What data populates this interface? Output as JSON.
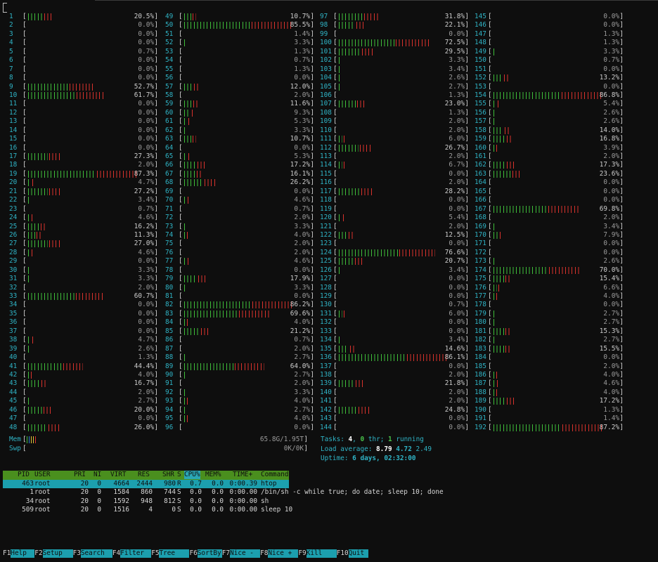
{
  "cpus": [
    {
      "id": "1",
      "pct": "20.5%",
      "v": 20.5
    },
    {
      "id": "2",
      "pct": "0.0%",
      "v": 0
    },
    {
      "id": "3",
      "pct": "0.0%",
      "v": 0
    },
    {
      "id": "4",
      "pct": "0.0%",
      "v": 0
    },
    {
      "id": "5",
      "pct": "0.7%",
      "v": 0.7
    },
    {
      "id": "6",
      "pct": "0.0%",
      "v": 0
    },
    {
      "id": "7",
      "pct": "0.0%",
      "v": 0
    },
    {
      "id": "8",
      "pct": "0.0%",
      "v": 0
    },
    {
      "id": "9",
      "pct": "52.7%",
      "v": 52.7
    },
    {
      "id": "10",
      "pct": "61.7%",
      "v": 61.7
    },
    {
      "id": "11",
      "pct": "0.0%",
      "v": 0
    },
    {
      "id": "12",
      "pct": "0.0%",
      "v": 0
    },
    {
      "id": "13",
      "pct": "0.0%",
      "v": 0
    },
    {
      "id": "14",
      "pct": "0.0%",
      "v": 0
    },
    {
      "id": "15",
      "pct": "0.0%",
      "v": 0
    },
    {
      "id": "16",
      "pct": "0.0%",
      "v": 0
    },
    {
      "id": "17",
      "pct": "27.3%",
      "v": 27.3
    },
    {
      "id": "18",
      "pct": "2.0%",
      "v": 2
    },
    {
      "id": "19",
      "pct": "87.3%",
      "v": 87.3
    },
    {
      "id": "20",
      "pct": "4.7%",
      "v": 4.7
    },
    {
      "id": "21",
      "pct": "27.2%",
      "v": 27.2
    },
    {
      "id": "22",
      "pct": "3.4%",
      "v": 3.4
    },
    {
      "id": "23",
      "pct": "0.7%",
      "v": 0.7
    },
    {
      "id": "24",
      "pct": "4.6%",
      "v": 4.6
    },
    {
      "id": "25",
      "pct": "16.2%",
      "v": 16.2
    },
    {
      "id": "26",
      "pct": "11.3%",
      "v": 11.3
    },
    {
      "id": "27",
      "pct": "27.0%",
      "v": 27
    },
    {
      "id": "28",
      "pct": "4.6%",
      "v": 4.6
    },
    {
      "id": "29",
      "pct": "0.0%",
      "v": 0
    },
    {
      "id": "30",
      "pct": "3.3%",
      "v": 3.3
    },
    {
      "id": "31",
      "pct": "3.3%",
      "v": 3.3
    },
    {
      "id": "32",
      "pct": "2.0%",
      "v": 2
    },
    {
      "id": "33",
      "pct": "60.7%",
      "v": 60.7
    },
    {
      "id": "34",
      "pct": "0.0%",
      "v": 0
    },
    {
      "id": "35",
      "pct": "0.0%",
      "v": 0
    },
    {
      "id": "36",
      "pct": "0.0%",
      "v": 0
    },
    {
      "id": "37",
      "pct": "0.0%",
      "v": 0
    },
    {
      "id": "38",
      "pct": "4.7%",
      "v": 4.7
    },
    {
      "id": "39",
      "pct": "2.6%",
      "v": 2.6
    },
    {
      "id": "40",
      "pct": "1.3%",
      "v": 1.3
    },
    {
      "id": "41",
      "pct": "44.4%",
      "v": 44.4
    },
    {
      "id": "42",
      "pct": "4.0%",
      "v": 4
    },
    {
      "id": "43",
      "pct": "16.7%",
      "v": 16.7
    },
    {
      "id": "44",
      "pct": "2.0%",
      "v": 2
    },
    {
      "id": "45",
      "pct": "2.7%",
      "v": 2.7
    },
    {
      "id": "46",
      "pct": "20.0%",
      "v": 20
    },
    {
      "id": "47",
      "pct": "0.0%",
      "v": 0
    },
    {
      "id": "48",
      "pct": "26.0%",
      "v": 26
    },
    {
      "id": "49",
      "pct": "10.7%",
      "v": 10.7
    },
    {
      "id": "50",
      "pct": "85.5%",
      "v": 85.5
    },
    {
      "id": "51",
      "pct": "1.4%",
      "v": 1.4
    },
    {
      "id": "52",
      "pct": "3.3%",
      "v": 3.3
    },
    {
      "id": "53",
      "pct": "1.3%",
      "v": 1.3
    },
    {
      "id": "54",
      "pct": "0.7%",
      "v": 0.7
    },
    {
      "id": "55",
      "pct": "1.3%",
      "v": 1.3
    },
    {
      "id": "56",
      "pct": "0.0%",
      "v": 0
    },
    {
      "id": "57",
      "pct": "12.0%",
      "v": 12
    },
    {
      "id": "58",
      "pct": "2.0%",
      "v": 2
    },
    {
      "id": "59",
      "pct": "11.6%",
      "v": 11.6
    },
    {
      "id": "60",
      "pct": "9.3%",
      "v": 9.3
    },
    {
      "id": "61",
      "pct": "5.3%",
      "v": 5.3
    },
    {
      "id": "62",
      "pct": "3.3%",
      "v": 3.3
    },
    {
      "id": "63",
      "pct": "10.7%",
      "v": 10.7
    },
    {
      "id": "64",
      "pct": "0.0%",
      "v": 0
    },
    {
      "id": "65",
      "pct": "5.3%",
      "v": 5.3
    },
    {
      "id": "66",
      "pct": "17.2%",
      "v": 17.2
    },
    {
      "id": "67",
      "pct": "16.1%",
      "v": 16.1
    },
    {
      "id": "68",
      "pct": "26.2%",
      "v": 26.2
    },
    {
      "id": "69",
      "pct": "0.0%",
      "v": 0
    },
    {
      "id": "70",
      "pct": "4.6%",
      "v": 4.6
    },
    {
      "id": "71",
      "pct": "0.7%",
      "v": 0.7
    },
    {
      "id": "72",
      "pct": "2.0%",
      "v": 2
    },
    {
      "id": "73",
      "pct": "3.3%",
      "v": 3.3
    },
    {
      "id": "74",
      "pct": "4.0%",
      "v": 4
    },
    {
      "id": "75",
      "pct": "2.0%",
      "v": 2
    },
    {
      "id": "76",
      "pct": "2.0%",
      "v": 2
    },
    {
      "id": "77",
      "pct": "4.6%",
      "v": 4.6
    },
    {
      "id": "78",
      "pct": "0.0%",
      "v": 0
    },
    {
      "id": "79",
      "pct": "17.9%",
      "v": 17.9
    },
    {
      "id": "80",
      "pct": "3.3%",
      "v": 3.3
    },
    {
      "id": "81",
      "pct": "0.0%",
      "v": 0
    },
    {
      "id": "82",
      "pct": "86.2%",
      "v": 86.2
    },
    {
      "id": "83",
      "pct": "69.6%",
      "v": 69.6
    },
    {
      "id": "84",
      "pct": "4.0%",
      "v": 4
    },
    {
      "id": "85",
      "pct": "21.2%",
      "v": 21.2
    },
    {
      "id": "86",
      "pct": "0.7%",
      "v": 0.7
    },
    {
      "id": "87",
      "pct": "2.0%",
      "v": 2
    },
    {
      "id": "88",
      "pct": "2.7%",
      "v": 2.7
    },
    {
      "id": "89",
      "pct": "64.0%",
      "v": 64
    },
    {
      "id": "90",
      "pct": "2.7%",
      "v": 2.7
    },
    {
      "id": "91",
      "pct": "2.0%",
      "v": 2
    },
    {
      "id": "92",
      "pct": "3.3%",
      "v": 3.3
    },
    {
      "id": "93",
      "pct": "4.0%",
      "v": 4
    },
    {
      "id": "94",
      "pct": "2.7%",
      "v": 2.7
    },
    {
      "id": "95",
      "pct": "4.0%",
      "v": 4
    },
    {
      "id": "96",
      "pct": "0.0%",
      "v": 0
    },
    {
      "id": "97",
      "pct": "31.8%",
      "v": 31.8
    },
    {
      "id": "98",
      "pct": "22.1%",
      "v": 22.1
    },
    {
      "id": "99",
      "pct": "0.0%",
      "v": 0
    },
    {
      "id": "100",
      "pct": "72.5%",
      "v": 72.5
    },
    {
      "id": "101",
      "pct": "29.5%",
      "v": 29.5
    },
    {
      "id": "102",
      "pct": "3.3%",
      "v": 3.3
    },
    {
      "id": "103",
      "pct": "3.4%",
      "v": 3.4
    },
    {
      "id": "104",
      "pct": "2.6%",
      "v": 2.6
    },
    {
      "id": "105",
      "pct": "2.7%",
      "v": 2.7
    },
    {
      "id": "106",
      "pct": "1.3%",
      "v": 1.3
    },
    {
      "id": "107",
      "pct": "23.0%",
      "v": 23
    },
    {
      "id": "108",
      "pct": "1.3%",
      "v": 1.3
    },
    {
      "id": "109",
      "pct": "2.0%",
      "v": 2
    },
    {
      "id": "110",
      "pct": "2.0%",
      "v": 2
    },
    {
      "id": "111",
      "pct": "6.0%",
      "v": 6
    },
    {
      "id": "112",
      "pct": "26.7%",
      "v": 26.7
    },
    {
      "id": "113",
      "pct": "2.0%",
      "v": 2
    },
    {
      "id": "114",
      "pct": "6.7%",
      "v": 6.7
    },
    {
      "id": "115",
      "pct": "0.0%",
      "v": 0
    },
    {
      "id": "116",
      "pct": "2.0%",
      "v": 2
    },
    {
      "id": "117",
      "pct": "28.2%",
      "v": 28.2
    },
    {
      "id": "118",
      "pct": "0.0%",
      "v": 0
    },
    {
      "id": "119",
      "pct": "0.0%",
      "v": 0
    },
    {
      "id": "120",
      "pct": "5.4%",
      "v": 5.4
    },
    {
      "id": "121",
      "pct": "2.0%",
      "v": 2
    },
    {
      "id": "122",
      "pct": "12.5%",
      "v": 12.5
    },
    {
      "id": "123",
      "pct": "0.0%",
      "v": 0
    },
    {
      "id": "124",
      "pct": "76.6%",
      "v": 76.6
    },
    {
      "id": "125",
      "pct": "20.7%",
      "v": 20.7
    },
    {
      "id": "126",
      "pct": "3.4%",
      "v": 3.4
    },
    {
      "id": "127",
      "pct": "0.0%",
      "v": 0
    },
    {
      "id": "128",
      "pct": "0.0%",
      "v": 0
    },
    {
      "id": "129",
      "pct": "0.0%",
      "v": 0
    },
    {
      "id": "130",
      "pct": "0.7%",
      "v": 0.7
    },
    {
      "id": "131",
      "pct": "6.0%",
      "v": 6
    },
    {
      "id": "132",
      "pct": "0.0%",
      "v": 0
    },
    {
      "id": "133",
      "pct": "0.0%",
      "v": 0
    },
    {
      "id": "134",
      "pct": "3.4%",
      "v": 3.4
    },
    {
      "id": "135",
      "pct": "14.6%",
      "v": 14.6
    },
    {
      "id": "136",
      "pct": "86.1%",
      "v": 86.1
    },
    {
      "id": "137",
      "pct": "0.0%",
      "v": 0
    },
    {
      "id": "138",
      "pct": "2.0%",
      "v": 2
    },
    {
      "id": "139",
      "pct": "21.8%",
      "v": 21.8
    },
    {
      "id": "140",
      "pct": "2.0%",
      "v": 2
    },
    {
      "id": "141",
      "pct": "2.0%",
      "v": 2
    },
    {
      "id": "142",
      "pct": "24.8%",
      "v": 24.8
    },
    {
      "id": "143",
      "pct": "0.0%",
      "v": 0
    },
    {
      "id": "144",
      "pct": "0.0%",
      "v": 0
    },
    {
      "id": "145",
      "pct": "0.0%",
      "v": 0
    },
    {
      "id": "146",
      "pct": "0.0%",
      "v": 0
    },
    {
      "id": "147",
      "pct": "1.3%",
      "v": 1.3
    },
    {
      "id": "148",
      "pct": "1.3%",
      "v": 1.3
    },
    {
      "id": "149",
      "pct": "3.3%",
      "v": 3.3
    },
    {
      "id": "150",
      "pct": "0.7%",
      "v": 0.7
    },
    {
      "id": "151",
      "pct": "0.0%",
      "v": 0
    },
    {
      "id": "152",
      "pct": "13.2%",
      "v": 13.2
    },
    {
      "id": "153",
      "pct": "0.0%",
      "v": 0
    },
    {
      "id": "154",
      "pct": "86.8%",
      "v": 86.8
    },
    {
      "id": "155",
      "pct": "5.4%",
      "v": 5.4
    },
    {
      "id": "156",
      "pct": "2.6%",
      "v": 2.6
    },
    {
      "id": "157",
      "pct": "2.6%",
      "v": 2.6
    },
    {
      "id": "158",
      "pct": "14.0%",
      "v": 14
    },
    {
      "id": "159",
      "pct": "16.8%",
      "v": 16.8
    },
    {
      "id": "160",
      "pct": "3.9%",
      "v": 3.9
    },
    {
      "id": "161",
      "pct": "2.0%",
      "v": 2
    },
    {
      "id": "162",
      "pct": "17.3%",
      "v": 17.3
    },
    {
      "id": "163",
      "pct": "23.6%",
      "v": 23.6
    },
    {
      "id": "164",
      "pct": "0.0%",
      "v": 0
    },
    {
      "id": "165",
      "pct": "0.0%",
      "v": 0
    },
    {
      "id": "166",
      "pct": "0.0%",
      "v": 0
    },
    {
      "id": "167",
      "pct": "69.8%",
      "v": 69.8
    },
    {
      "id": "168",
      "pct": "2.0%",
      "v": 2
    },
    {
      "id": "169",
      "pct": "3.4%",
      "v": 3.4
    },
    {
      "id": "170",
      "pct": "7.9%",
      "v": 7.9
    },
    {
      "id": "171",
      "pct": "0.0%",
      "v": 0
    },
    {
      "id": "172",
      "pct": "0.0%",
      "v": 0
    },
    {
      "id": "173",
      "pct": "2.6%",
      "v": 2.6
    },
    {
      "id": "174",
      "pct": "70.0%",
      "v": 70
    },
    {
      "id": "175",
      "pct": "15.4%",
      "v": 15.4
    },
    {
      "id": "176",
      "pct": "6.6%",
      "v": 6.6
    },
    {
      "id": "177",
      "pct": "4.0%",
      "v": 4
    },
    {
      "id": "178",
      "pct": "0.0%",
      "v": 0
    },
    {
      "id": "179",
      "pct": "2.7%",
      "v": 2.7
    },
    {
      "id": "180",
      "pct": "2.7%",
      "v": 2.7
    },
    {
      "id": "181",
      "pct": "15.3%",
      "v": 15.3
    },
    {
      "id": "182",
      "pct": "2.7%",
      "v": 2.7
    },
    {
      "id": "183",
      "pct": "15.5%",
      "v": 15.5
    },
    {
      "id": "184",
      "pct": "0.0%",
      "v": 0
    },
    {
      "id": "185",
      "pct": "2.0%",
      "v": 2
    },
    {
      "id": "186",
      "pct": "4.0%",
      "v": 4
    },
    {
      "id": "187",
      "pct": "4.6%",
      "v": 4.6
    },
    {
      "id": "188",
      "pct": "4.0%",
      "v": 4
    },
    {
      "id": "189",
      "pct": "17.2%",
      "v": 17.2
    },
    {
      "id": "190",
      "pct": "1.3%",
      "v": 1.3
    },
    {
      "id": "191",
      "pct": "1.4%",
      "v": 1.4
    },
    {
      "id": "192",
      "pct": "87.2%",
      "v": 87.2
    }
  ],
  "memory": {
    "label": "Mem",
    "value": "65.8G/1.95T",
    "used_fraction": 0.035
  },
  "swap": {
    "label": "Swp",
    "value": "0K/0K",
    "used_fraction": 0
  },
  "tasks": {
    "label": "Tasks:",
    "count": "4",
    "sep1": ",",
    "thr": "0",
    "thr_label": "thr;",
    "running": "1",
    "running_label": "running"
  },
  "load": {
    "label": "Load average:",
    "l1": "8.79",
    "l5": "4.72",
    "l15": "2.49"
  },
  "uptime": {
    "label": "Uptime:",
    "value": "6 days, 02:32:00"
  },
  "columns": [
    "PID",
    "USER",
    "PRI",
    "NI",
    "VIRT",
    "RES",
    "SHR",
    "S",
    "CPU%",
    "MEM%",
    "TIME+",
    "Command"
  ],
  "processes": [
    {
      "pid": "463",
      "user": "root",
      "pri": "20",
      "ni": "0",
      "virt": "4664",
      "res": "2444",
      "shr": "980",
      "s": "R",
      "cpu": "0.7",
      "mem": "0.0",
      "time": "0:00.39",
      "cmd": "htop"
    },
    {
      "pid": "1",
      "user": "root",
      "pri": "20",
      "ni": "0",
      "virt": "1584",
      "res": "860",
      "shr": "744",
      "s": "S",
      "cpu": "0.0",
      "mem": "0.0",
      "time": "0:00.00",
      "cmd": "/bin/sh -c while true; do date; sleep 10; done"
    },
    {
      "pid": "34",
      "user": "root",
      "pri": "20",
      "ni": "0",
      "virt": "1592",
      "res": "948",
      "shr": "812",
      "s": "S",
      "cpu": "0.0",
      "mem": "0.0",
      "time": "0:00.00",
      "cmd": "sh"
    },
    {
      "pid": "509",
      "user": "root",
      "pri": "20",
      "ni": "0",
      "virt": "1516",
      "res": "4",
      "shr": "0",
      "s": "S",
      "cpu": "0.0",
      "mem": "0.0",
      "time": "0:00.00",
      "cmd": "sleep 10"
    }
  ],
  "fkeys": [
    {
      "key": "F1",
      "label": "Help"
    },
    {
      "key": "F2",
      "label": "Setup"
    },
    {
      "key": "F3",
      "label": "Search"
    },
    {
      "key": "F4",
      "label": "Filter"
    },
    {
      "key": "F5",
      "label": "Tree"
    },
    {
      "key": "F6",
      "label": "SortBy"
    },
    {
      "key": "F7",
      "label": "Nice -"
    },
    {
      "key": "F8",
      "label": "Nice +"
    },
    {
      "key": "F9",
      "label": "Kill"
    },
    {
      "key": "F10",
      "label": "Quit"
    }
  ],
  "colors": {
    "low": "#3fbe3a",
    "kernel": "#d8322c",
    "cyan": "#2fb3c5",
    "header_bg": "#4a8f1e",
    "select_bg": "#1c9fae",
    "mem_used": "#3fbe3a",
    "mem_buf": "#2f7fd6",
    "mem_cache": "#e2c33a"
  }
}
